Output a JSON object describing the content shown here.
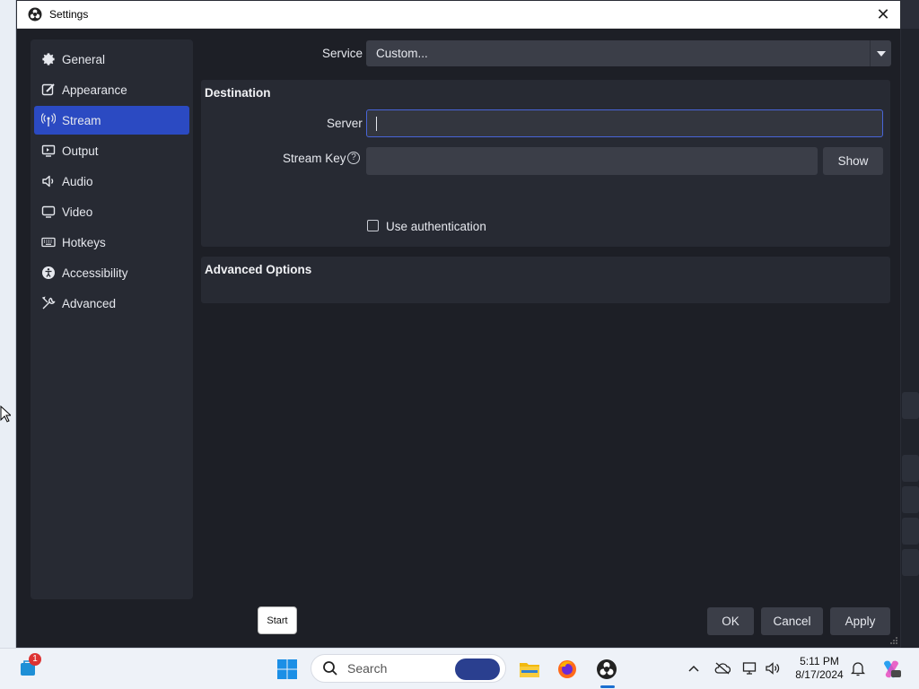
{
  "window": {
    "title": "Settings"
  },
  "sidebar": {
    "items": [
      {
        "label": "General",
        "icon": "gear-icon"
      },
      {
        "label": "Appearance",
        "icon": "brush-icon"
      },
      {
        "label": "Stream",
        "icon": "antenna-icon",
        "active": true
      },
      {
        "label": "Output",
        "icon": "output-icon"
      },
      {
        "label": "Audio",
        "icon": "speaker-icon"
      },
      {
        "label": "Video",
        "icon": "monitor-icon"
      },
      {
        "label": "Hotkeys",
        "icon": "keyboard-icon"
      },
      {
        "label": "Accessibility",
        "icon": "accessibility-icon"
      },
      {
        "label": "Advanced",
        "icon": "wrench-icon"
      }
    ]
  },
  "stream": {
    "service_label": "Service",
    "service_value": "Custom...",
    "destination": {
      "title": "Destination",
      "server_label": "Server",
      "server_value": "",
      "stream_key_label": "Stream Key",
      "stream_key_value": "",
      "show_button": "Show",
      "use_auth_label": "Use authentication",
      "use_auth_checked": false
    },
    "advanced_title": "Advanced Options"
  },
  "footer": {
    "ok": "OK",
    "cancel": "Cancel",
    "apply": "Apply"
  },
  "overlay": {
    "start_label": "Start"
  },
  "taskbar": {
    "search_placeholder": "Search",
    "notification_count": "1",
    "time": "5:11 PM",
    "date": "8/17/2024"
  },
  "colors": {
    "accent": "#2b4ac2",
    "dialog_bg": "#1d1f26",
    "panel_bg": "#272a33",
    "control_bg": "#3b3e48",
    "focus_border": "#4865d8"
  }
}
